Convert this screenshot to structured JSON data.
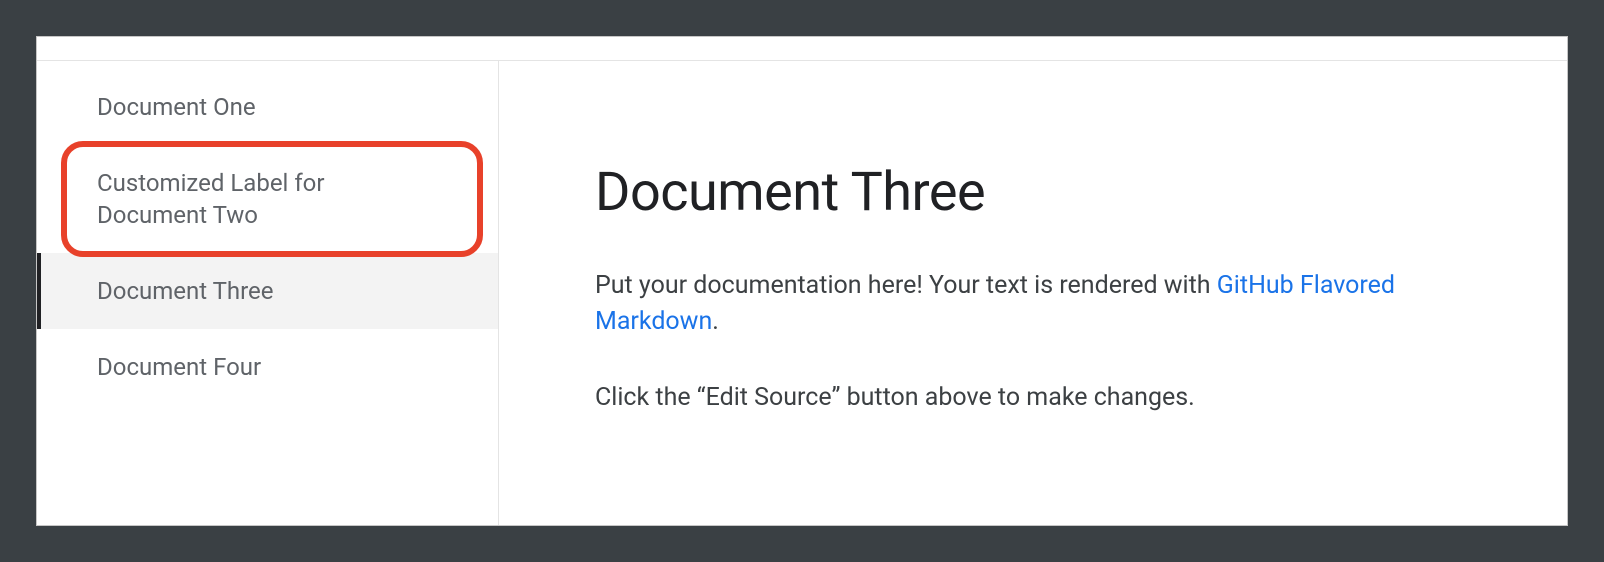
{
  "sidebar": {
    "items": [
      {
        "label": "Document One",
        "active": false
      },
      {
        "label": "Customized Label for Document Two",
        "active": false
      },
      {
        "label": "Document Three",
        "active": true
      },
      {
        "label": "Document Four",
        "active": false
      }
    ],
    "highlighted_index": 1
  },
  "content": {
    "title": "Document Three",
    "paragraph1_prefix": "Put your documentation here! Your text is rendered with ",
    "paragraph1_link": "GitHub Flavored Markdown",
    "paragraph1_suffix": ".",
    "paragraph2": "Click the “Edit Source” button above to make changes."
  }
}
